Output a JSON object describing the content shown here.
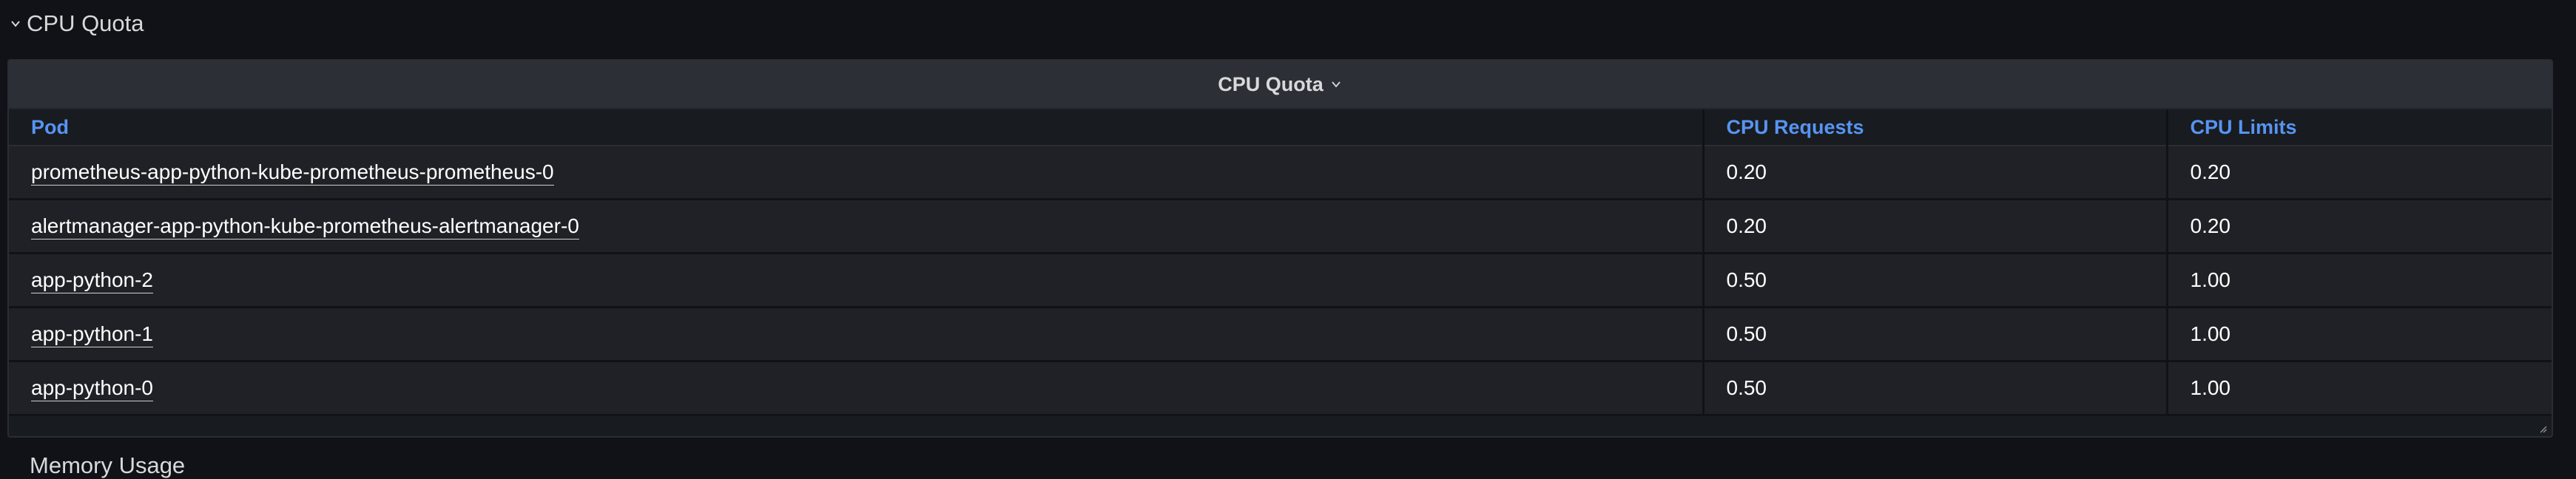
{
  "row": {
    "title": "CPU Quota"
  },
  "panel": {
    "title": "CPU Quota",
    "columns": [
      "Pod",
      "CPU Requests",
      "CPU Limits"
    ],
    "rows": [
      {
        "pod": "prometheus-app-python-kube-prometheus-prometheus-0",
        "requests": "0.20",
        "limits": "0.20"
      },
      {
        "pod": "alertmanager-app-python-kube-prometheus-alertmanager-0",
        "requests": "0.20",
        "limits": "0.20"
      },
      {
        "pod": "app-python-2",
        "requests": "0.50",
        "limits": "1.00"
      },
      {
        "pod": "app-python-1",
        "requests": "0.50",
        "limits": "1.00"
      },
      {
        "pod": "app-python-0",
        "requests": "0.50",
        "limits": "1.00"
      }
    ]
  },
  "next_row": {
    "title": "Memory Usage"
  },
  "icons": {
    "row_toggle": "chevron-down-icon",
    "panel_menu": "chevron-down-icon",
    "resize": "resize-handle-icon"
  },
  "colors": {
    "background": "#111217",
    "panel": "#181b1f",
    "header_link": "#5794f2"
  }
}
